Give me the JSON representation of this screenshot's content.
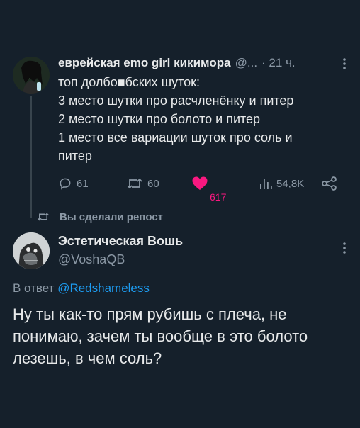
{
  "quoted_tweet": {
    "author_name": "еврейская emo girl кикимора",
    "author_handle": "@...",
    "time": "· 21 ч.",
    "body_lines": [
      "топ долбо■бских шуток:",
      "3 место шутки про расчленёнку и питер",
      "2 место шутки про болото и питер",
      "1 место все вариации шуток про соль и",
      "питер"
    ],
    "replies": "61",
    "retweets": "60",
    "likes": "617",
    "views": "54,8K"
  },
  "repost_label": "Вы сделали репост",
  "reply_tweet": {
    "author_name": "Эстетическая Вошь",
    "author_handle": "@VoshaQB",
    "reply_prefix": "В ответ",
    "reply_mention": "@Redshameless",
    "body_lines": [
      "Ну ты как-то прям рубишь с плеча, не",
      "понимаю, зачем ты вообще в это болото",
      "лезешь, в чем соль?"
    ]
  },
  "colors": {
    "background": "#15202b",
    "text": "#e7e9ea",
    "muted": "#8b98a5",
    "like": "#f91880",
    "link": "#1d9bf0"
  },
  "icons": [
    "reply-icon",
    "retweet-icon",
    "heart-icon",
    "views-icon",
    "share-icon",
    "more-icon"
  ]
}
